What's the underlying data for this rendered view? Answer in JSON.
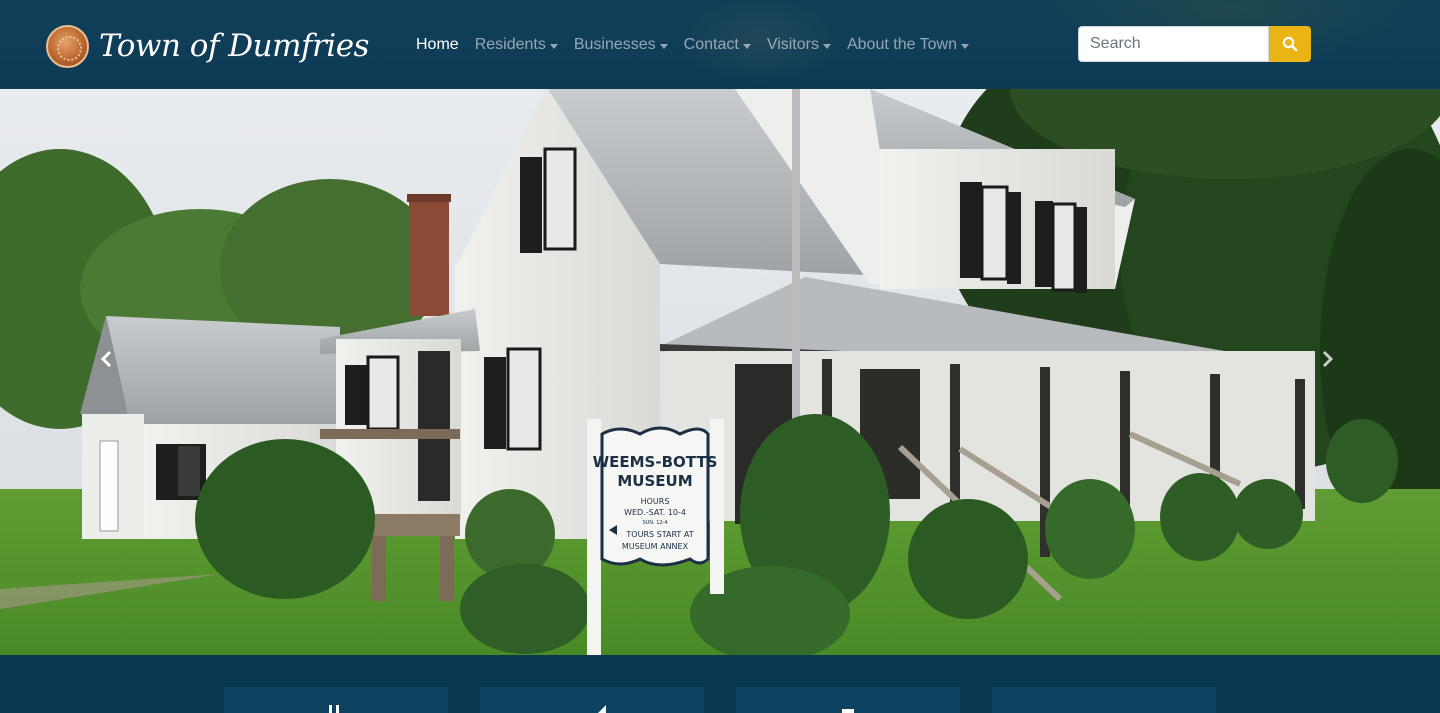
{
  "brand": {
    "name": "Town of Dumfries",
    "seal_icon": "town-seal-icon"
  },
  "nav": {
    "items": [
      {
        "label": "Home",
        "active": true,
        "dropdown": false
      },
      {
        "label": "Residents",
        "active": false,
        "dropdown": true
      },
      {
        "label": "Businesses",
        "active": false,
        "dropdown": true
      },
      {
        "label": "Contact",
        "active": false,
        "dropdown": true
      },
      {
        "label": "Visitors",
        "active": false,
        "dropdown": true
      },
      {
        "label": "About the Town",
        "active": false,
        "dropdown": true
      }
    ]
  },
  "search": {
    "placeholder": "Search",
    "value": "",
    "button_icon": "search-icon"
  },
  "hero": {
    "sign": {
      "line1": "WEEMS-BOTTS",
      "line2": "MUSEUM",
      "hours_label": "HOURS",
      "hours": "WED.-SAT. 10-4",
      "hours_sub": "SUN. 12-4",
      "tours_line1": "TOURS START AT",
      "tours_line2": "MUSEUM ANNEX"
    },
    "prev_icon": "chevron-left-icon",
    "next_icon": "chevron-right-icon"
  },
  "colors": {
    "navbar": "#0d3b56",
    "search_button": "#e9b414",
    "strip": "#0a3853"
  }
}
